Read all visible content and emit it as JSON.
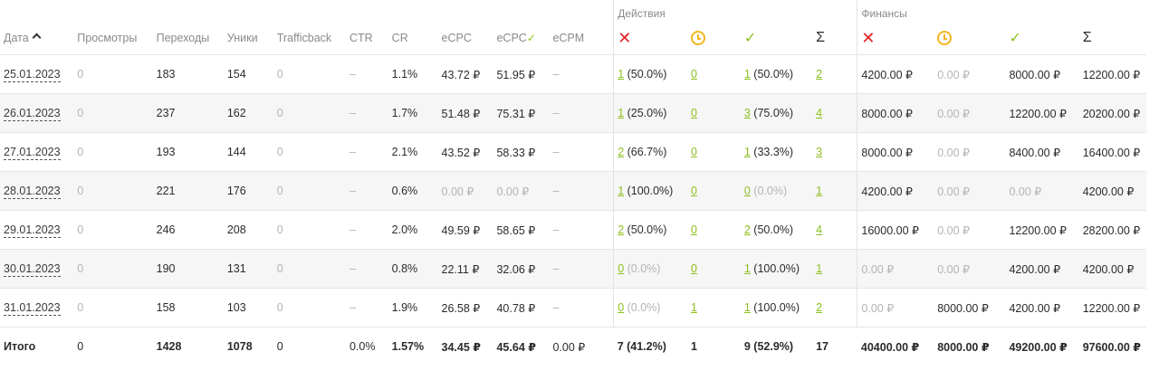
{
  "groups": {
    "actions": "Действия",
    "finance": "Финансы"
  },
  "columns": {
    "date": "Дата",
    "views": "Просмотры",
    "clicks": "Переходы",
    "uniques": "Уники",
    "trafficback": "Trafficback",
    "ctr": "CTR",
    "cr": "CR",
    "ecpc": "eCPC",
    "ecpc_confirmed": "eCPC",
    "ecpm": "eCPM"
  },
  "header_icons": {
    "rejected": "close-icon",
    "pending": "clock-icon",
    "approved": "check-icon",
    "sum": "Σ"
  },
  "colors": {
    "accent": "#8cbf1e",
    "rejected": "#e02020",
    "pending": "#f4b51f"
  },
  "rows": [
    {
      "date": "25.01.2023",
      "views": "0",
      "clicks": "183",
      "uniques": "154",
      "trafficback": "0",
      "ctr": "–",
      "cr": "1.1%",
      "ecpc": "43.72 ₽",
      "ecpc_c": "51.95 ₽",
      "ecpm": "–",
      "act_rej_n": "1",
      "act_rej_p": " (50.0%)",
      "act_pend": "0",
      "act_app_n": "1",
      "act_app_p": " (50.0%)",
      "act_sum": "2",
      "fin_rej": "4200.00 ₽",
      "fin_pend": "0.00 ₽",
      "fin_app": "8000.00 ₽",
      "fin_sum": "12200.00 ₽"
    },
    {
      "date": "26.01.2023",
      "views": "0",
      "clicks": "237",
      "uniques": "162",
      "trafficback": "0",
      "ctr": "–",
      "cr": "1.7%",
      "ecpc": "51.48 ₽",
      "ecpc_c": "75.31 ₽",
      "ecpm": "–",
      "act_rej_n": "1",
      "act_rej_p": " (25.0%)",
      "act_pend": "0",
      "act_app_n": "3",
      "act_app_p": " (75.0%)",
      "act_sum": "4",
      "fin_rej": "8000.00 ₽",
      "fin_pend": "0.00 ₽",
      "fin_app": "12200.00 ₽",
      "fin_sum": "20200.00 ₽"
    },
    {
      "date": "27.01.2023",
      "views": "0",
      "clicks": "193",
      "uniques": "144",
      "trafficback": "0",
      "ctr": "–",
      "cr": "2.1%",
      "ecpc": "43.52 ₽",
      "ecpc_c": "58.33 ₽",
      "ecpm": "–",
      "act_rej_n": "2",
      "act_rej_p": " (66.7%)",
      "act_pend": "0",
      "act_app_n": "1",
      "act_app_p": " (33.3%)",
      "act_sum": "3",
      "fin_rej": "8000.00 ₽",
      "fin_pend": "0.00 ₽",
      "fin_app": "8400.00 ₽",
      "fin_sum": "16400.00 ₽"
    },
    {
      "date": "28.01.2023",
      "views": "0",
      "clicks": "221",
      "uniques": "176",
      "trafficback": "0",
      "ctr": "–",
      "cr": "0.6%",
      "ecpc": "0.00 ₽",
      "ecpc_c": "0.00 ₽",
      "ecpm": "–",
      "act_rej_n": "1",
      "act_rej_p": " (100.0%)",
      "act_pend": "0",
      "act_app_n": "0",
      "act_app_p": " (0.0%)",
      "act_sum": "1",
      "fin_rej": "4200.00 ₽",
      "fin_pend": "0.00 ₽",
      "fin_app": "0.00 ₽",
      "fin_sum": "4200.00 ₽"
    },
    {
      "date": "29.01.2023",
      "views": "0",
      "clicks": "246",
      "uniques": "208",
      "trafficback": "0",
      "ctr": "–",
      "cr": "2.0%",
      "ecpc": "49.59 ₽",
      "ecpc_c": "58.65 ₽",
      "ecpm": "–",
      "act_rej_n": "2",
      "act_rej_p": " (50.0%)",
      "act_pend": "0",
      "act_app_n": "2",
      "act_app_p": " (50.0%)",
      "act_sum": "4",
      "fin_rej": "16000.00 ₽",
      "fin_pend": "0.00 ₽",
      "fin_app": "12200.00 ₽",
      "fin_sum": "28200.00 ₽"
    },
    {
      "date": "30.01.2023",
      "views": "0",
      "clicks": "190",
      "uniques": "131",
      "trafficback": "0",
      "ctr": "–",
      "cr": "0.8%",
      "ecpc": "22.11 ₽",
      "ecpc_c": "32.06 ₽",
      "ecpm": "–",
      "act_rej_n": "0",
      "act_rej_p": " (0.0%)",
      "act_pend": "0",
      "act_app_n": "1",
      "act_app_p": " (100.0%)",
      "act_sum": "1",
      "fin_rej": "0.00 ₽",
      "fin_pend": "0.00 ₽",
      "fin_app": "4200.00 ₽",
      "fin_sum": "4200.00 ₽"
    },
    {
      "date": "31.01.2023",
      "views": "0",
      "clicks": "158",
      "uniques": "103",
      "trafficback": "0",
      "ctr": "–",
      "cr": "1.9%",
      "ecpc": "26.58 ₽",
      "ecpc_c": "40.78 ₽",
      "ecpm": "–",
      "act_rej_n": "0",
      "act_rej_p": " (0.0%)",
      "act_pend": "1",
      "act_app_n": "1",
      "act_app_p": " (100.0%)",
      "act_sum": "2",
      "fin_rej": "0.00 ₽",
      "fin_pend": "8000.00 ₽",
      "fin_app": "4200.00 ₽",
      "fin_sum": "12200.00 ₽"
    }
  ],
  "total": {
    "label": "Итого",
    "views": "0",
    "clicks": "1428",
    "uniques": "1078",
    "trafficback": "0",
    "ctr": "0.0%",
    "cr": "1.57%",
    "ecpc": "34.45 ₽",
    "ecpc_c": "45.64 ₽",
    "ecpm": "0.00 ₽",
    "act_rej": "7 (41.2%)",
    "act_pend": "1",
    "act_app": "9 (52.9%)",
    "act_sum": "17",
    "fin_rej": "40400.00 ₽",
    "fin_pend": "8000.00 ₽",
    "fin_app": "49200.00 ₽",
    "fin_sum": "97600.00 ₽"
  }
}
